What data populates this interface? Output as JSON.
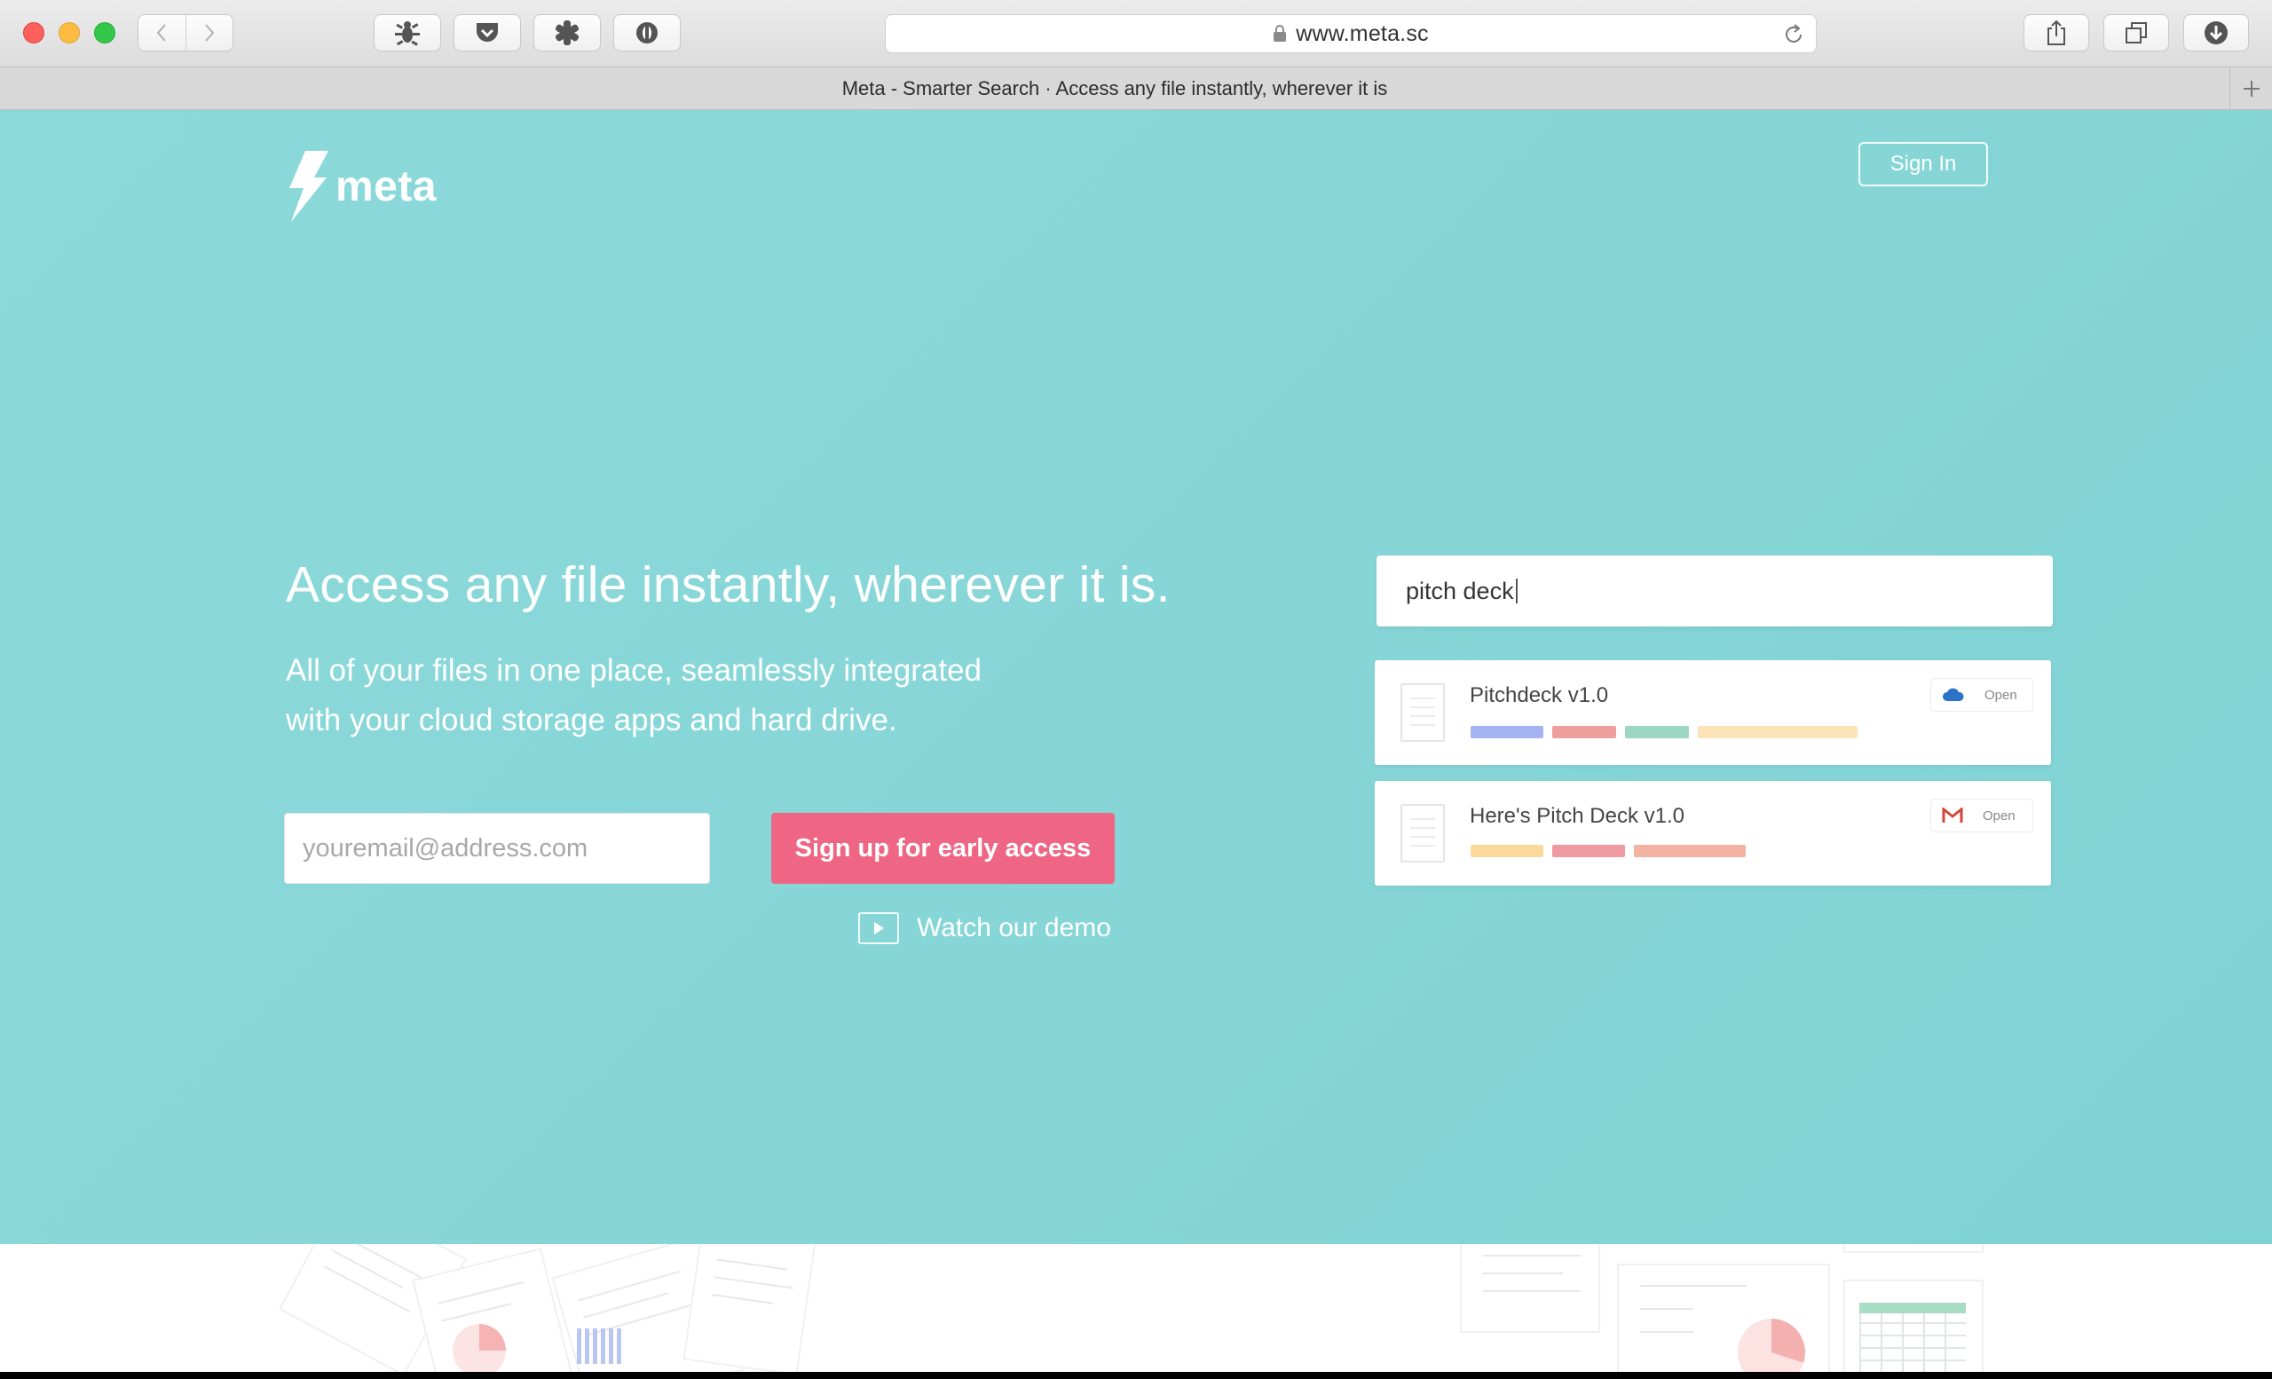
{
  "browser": {
    "url": "www.meta.sc",
    "tab_title": "Meta - Smarter Search · Access any file instantly, wherever it is"
  },
  "page": {
    "brand": "meta",
    "signin_label": "Sign In",
    "headline": "Access any file instantly, wherever it is.",
    "sub_line1": "All of your files in one place, seamlessly integrated",
    "sub_line2": "with your cloud storage apps and hard drive.",
    "email_placeholder": "youremail@address.com",
    "cta_label": "Sign up for early access",
    "demo_label": "Watch our demo"
  },
  "search": {
    "query": "pitch deck",
    "results": [
      {
        "title": "Pitchdeck v1.0",
        "source_icon": "cloud-icon",
        "source_color": "#2b73c6",
        "open_label": "Open",
        "tag_colors": [
          "#a4b4f0",
          "#ef9e9e",
          "#9ed6c4",
          "#fce3b8"
        ]
      },
      {
        "title": "Here's Pitch Deck v1.0",
        "source_icon": "gmail-icon",
        "source_color": "#d44638",
        "open_label": "Open",
        "tag_colors": [
          "#fbd99a",
          "#ef9aa0",
          "#f3b2a2"
        ]
      }
    ]
  },
  "colors": {
    "hero_bg": "#87d6d7",
    "cta_bg": "#ef6685"
  }
}
